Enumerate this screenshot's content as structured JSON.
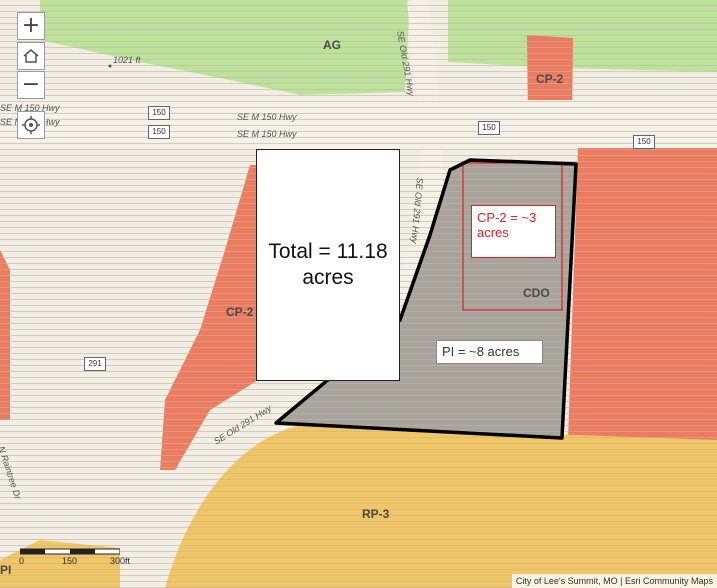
{
  "map": {
    "zoom_in_label": "+",
    "zoom_out_label": "−",
    "zones": {
      "ag": "AG",
      "cp2_top": "CP-2",
      "cp2_left": "CP-2",
      "cdo": "CDO",
      "rp3": "RP-3",
      "pi": "PI"
    },
    "roads": {
      "m150_a": "SE M 150 Hwy",
      "m150_b": "SE M 150 Hwy",
      "m150_c": "SE M 150 Hwy",
      "old291_top": "SE Old 291 Hwy",
      "old291_mid": "SE Old 291 Hwy",
      "old291_bottom": "SE Old 291 Hwy",
      "raintree": "N Raintree Dr"
    },
    "shields": {
      "s150_a": "150",
      "s150_b": "150",
      "s150_c": "150",
      "s150_d": "150",
      "s291": "291"
    },
    "elevation": "1021 ft",
    "annotations": {
      "total": "Total = 11.18 acres",
      "cp2": "CP-2 = ~3 acres",
      "pi": "PI = ~8 acres"
    },
    "scale": {
      "t0": "0",
      "t1": "150",
      "t2": "300ft"
    },
    "attribution": "City of Lee's Summit, MO | Esri Community Maps"
  },
  "colors": {
    "ag": "#bde39a",
    "commercial": "#f07a5e",
    "residential": "#f2c663",
    "pi_fill": "#a8a49c",
    "base": "#f3eee4",
    "annotation_red": "#e02020"
  }
}
